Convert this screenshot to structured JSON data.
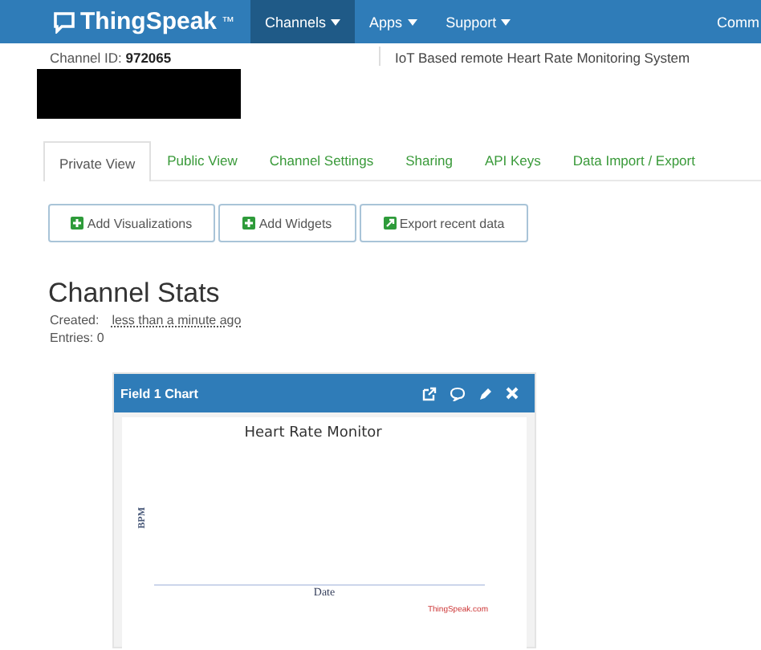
{
  "navbar": {
    "brand": "ThingSpeak",
    "trademark": "™",
    "menus": [
      {
        "label": "Channels",
        "selected": true
      },
      {
        "label": "Apps",
        "selected": false
      },
      {
        "label": "Support",
        "selected": false
      }
    ],
    "right_link": "Comm"
  },
  "channel": {
    "id_label": "Channel ID:",
    "id": "972065",
    "description": "IoT Based remote Heart Rate Monitoring System"
  },
  "tabs": [
    {
      "label": "Private View",
      "selected": true
    },
    {
      "label": "Public View",
      "selected": false
    },
    {
      "label": "Channel Settings",
      "selected": false
    },
    {
      "label": "Sharing",
      "selected": false
    },
    {
      "label": "API Keys",
      "selected": false
    },
    {
      "label": "Data Import / Export",
      "selected": false
    }
  ],
  "buttons": [
    {
      "label": "Add Visualizations",
      "kind": "plus"
    },
    {
      "label": "Add Widgets",
      "kind": "plus"
    },
    {
      "label": "Export recent data",
      "kind": "export"
    }
  ],
  "stats": {
    "title": "Channel Stats",
    "created_label": "Created:",
    "created": "less than a minute ago",
    "entries": "Entries: 0"
  },
  "chart_panel": {
    "title": "Field 1 Chart",
    "chart_title": "Heart Rate Monitor",
    "ylabel": "BPM",
    "xlabel": "Date",
    "credit": "ThingSpeak.com"
  }
}
